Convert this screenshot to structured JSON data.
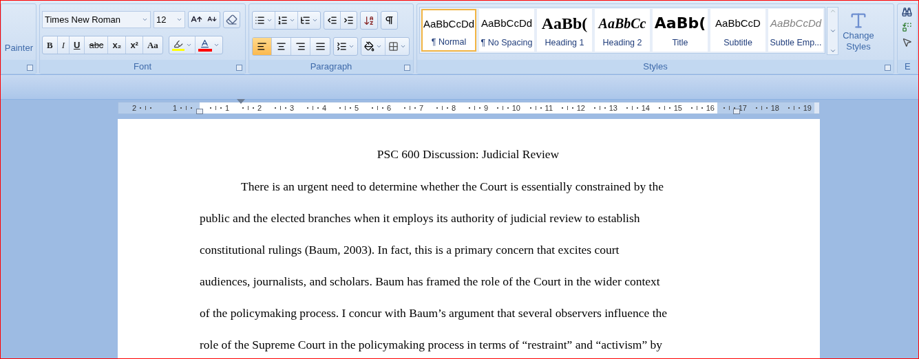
{
  "ribbon": {
    "clipboard": {
      "label": "Painter"
    },
    "font": {
      "label": "Font",
      "font_name": "Times New Roman",
      "font_size": "12",
      "format_buttons": [
        {
          "kind": "bold",
          "text": "B"
        },
        {
          "kind": "italic",
          "text": "I"
        },
        {
          "kind": "underline",
          "text": "U"
        },
        {
          "kind": "strike",
          "text": "abc"
        },
        {
          "kind": "subscript",
          "text": "x₂"
        },
        {
          "kind": "superscript",
          "text": "x²"
        },
        {
          "kind": "case",
          "text": "Aa"
        }
      ],
      "font_color_bar": true
    },
    "paragraph": {
      "label": "Paragraph",
      "alignments": [
        {
          "kind": "left",
          "selected": true
        },
        {
          "kind": "center",
          "selected": false
        },
        {
          "kind": "right",
          "selected": false
        },
        {
          "kind": "justify",
          "selected": false
        }
      ]
    },
    "styles": {
      "label": "Styles",
      "items": [
        {
          "kind": "normal",
          "preview": "AaBbCcDd",
          "name": "¶ Normal",
          "selected": true
        },
        {
          "kind": "plain",
          "preview": "AaBbCcDd",
          "name": "¶ No Spacing",
          "selected": false
        },
        {
          "kind": "heading1",
          "preview": "AaBb(",
          "name": "Heading 1",
          "selected": false
        },
        {
          "kind": "heading2",
          "preview": "AaBbCc",
          "name": "Heading 2",
          "selected": false
        },
        {
          "kind": "title",
          "preview": "AaBb(",
          "name": "Title",
          "selected": false
        },
        {
          "kind": "plain",
          "preview": "AaBbCcD",
          "name": "Subtitle",
          "selected": false
        },
        {
          "kind": "subtle",
          "preview": "AaBbCcDd",
          "name": "Subtle Emp...",
          "selected": false
        }
      ],
      "change_styles": "Change Styles"
    },
    "editing": {
      "label": "E"
    }
  },
  "ruler": [
    {
      "label": "2",
      "margin": true
    },
    {
      "label": "1",
      "margin": true
    },
    {
      "label": "1",
      "margin": false
    },
    {
      "label": "2",
      "margin": false
    },
    {
      "label": "3",
      "margin": false
    },
    {
      "label": "4",
      "margin": false
    },
    {
      "label": "5",
      "margin": false
    },
    {
      "label": "6",
      "margin": false
    },
    {
      "label": "7",
      "margin": false
    },
    {
      "label": "8",
      "margin": false
    },
    {
      "label": "9",
      "margin": false
    },
    {
      "label": "10",
      "margin": false
    },
    {
      "label": "11",
      "margin": false
    },
    {
      "label": "12",
      "margin": false
    },
    {
      "label": "13",
      "margin": false
    },
    {
      "label": "14",
      "margin": false
    },
    {
      "label": "15",
      "margin": false
    },
    {
      "label": "16",
      "margin": false
    },
    {
      "label": "17",
      "margin": true
    },
    {
      "label": "18",
      "margin": true
    },
    {
      "label": "19",
      "margin": true
    }
  ],
  "document": {
    "title": "PSC 600 Discussion: Judicial Review",
    "lines": [
      {
        "text": "There is an urgent need to determine whether the Court is essentially constrained by the",
        "indent": true
      },
      {
        "text": "public and the elected branches when it employs its authority of judicial review to establish",
        "indent": false
      },
      {
        "text": "constitutional rulings (Baum, 2003). In fact, this is a primary concern that excites court",
        "indent": false
      },
      {
        "text": "audiences, journalists, and scholars. Baum has framed the role of the Court in the wider context",
        "indent": false
      },
      {
        "text": "of the policymaking process. I concur with Baum’s argument that several observers influence the",
        "indent": false
      },
      {
        "text": "role of the Supreme Court in the policymaking process in terms of “restraint” and “activism” by",
        "indent": false
      }
    ]
  }
}
